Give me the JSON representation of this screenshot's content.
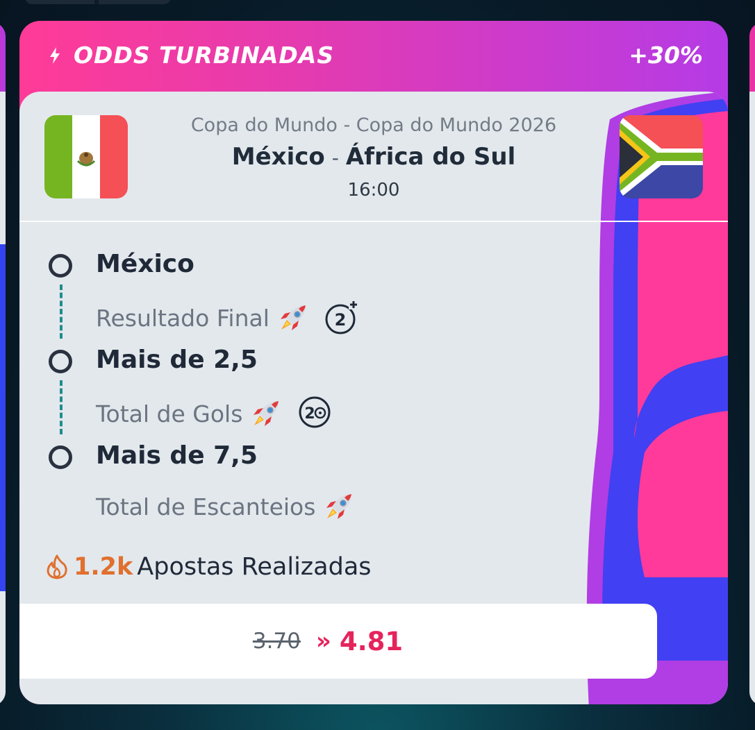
{
  "promo": {
    "title": "ODDS TURBINADAS",
    "boost": "+30%",
    "bolt_icon": "bolt-icon"
  },
  "match": {
    "competition": "Copa do Mundo - Copa do Mundo 2026",
    "home_team": "México",
    "separator": "-",
    "away_team": "África do Sul",
    "time": "16:00",
    "home_flag": "mexico-flag",
    "away_flag": "south-africa-flag"
  },
  "selections": [
    {
      "pick": "México",
      "market": "Resultado Final",
      "market_icon": "rocket-icon",
      "extra_icon": "two-goals-ahead-icon"
    },
    {
      "pick": "Mais de 2,5",
      "market": "Total de Gols",
      "market_icon": "rocket-icon",
      "extra_icon": "two-goal-icon"
    },
    {
      "pick": "Mais de 7,5",
      "market": "Total de Escanteios",
      "market_icon": "rocket-icon"
    }
  ],
  "bets": {
    "count": "1.2k",
    "label": "Apostas Realizadas",
    "icon": "fire-icon"
  },
  "odds": {
    "old": "3.70",
    "arrows": "»",
    "new": "4.81"
  },
  "colors": {
    "banner_start": "#ff3b97",
    "banner_end": "#b53be6",
    "card_bg": "#e3e8ed",
    "odds_accent": "#e5245c",
    "bets_accent": "#e0702e",
    "timeline": "#1e8c8e"
  }
}
